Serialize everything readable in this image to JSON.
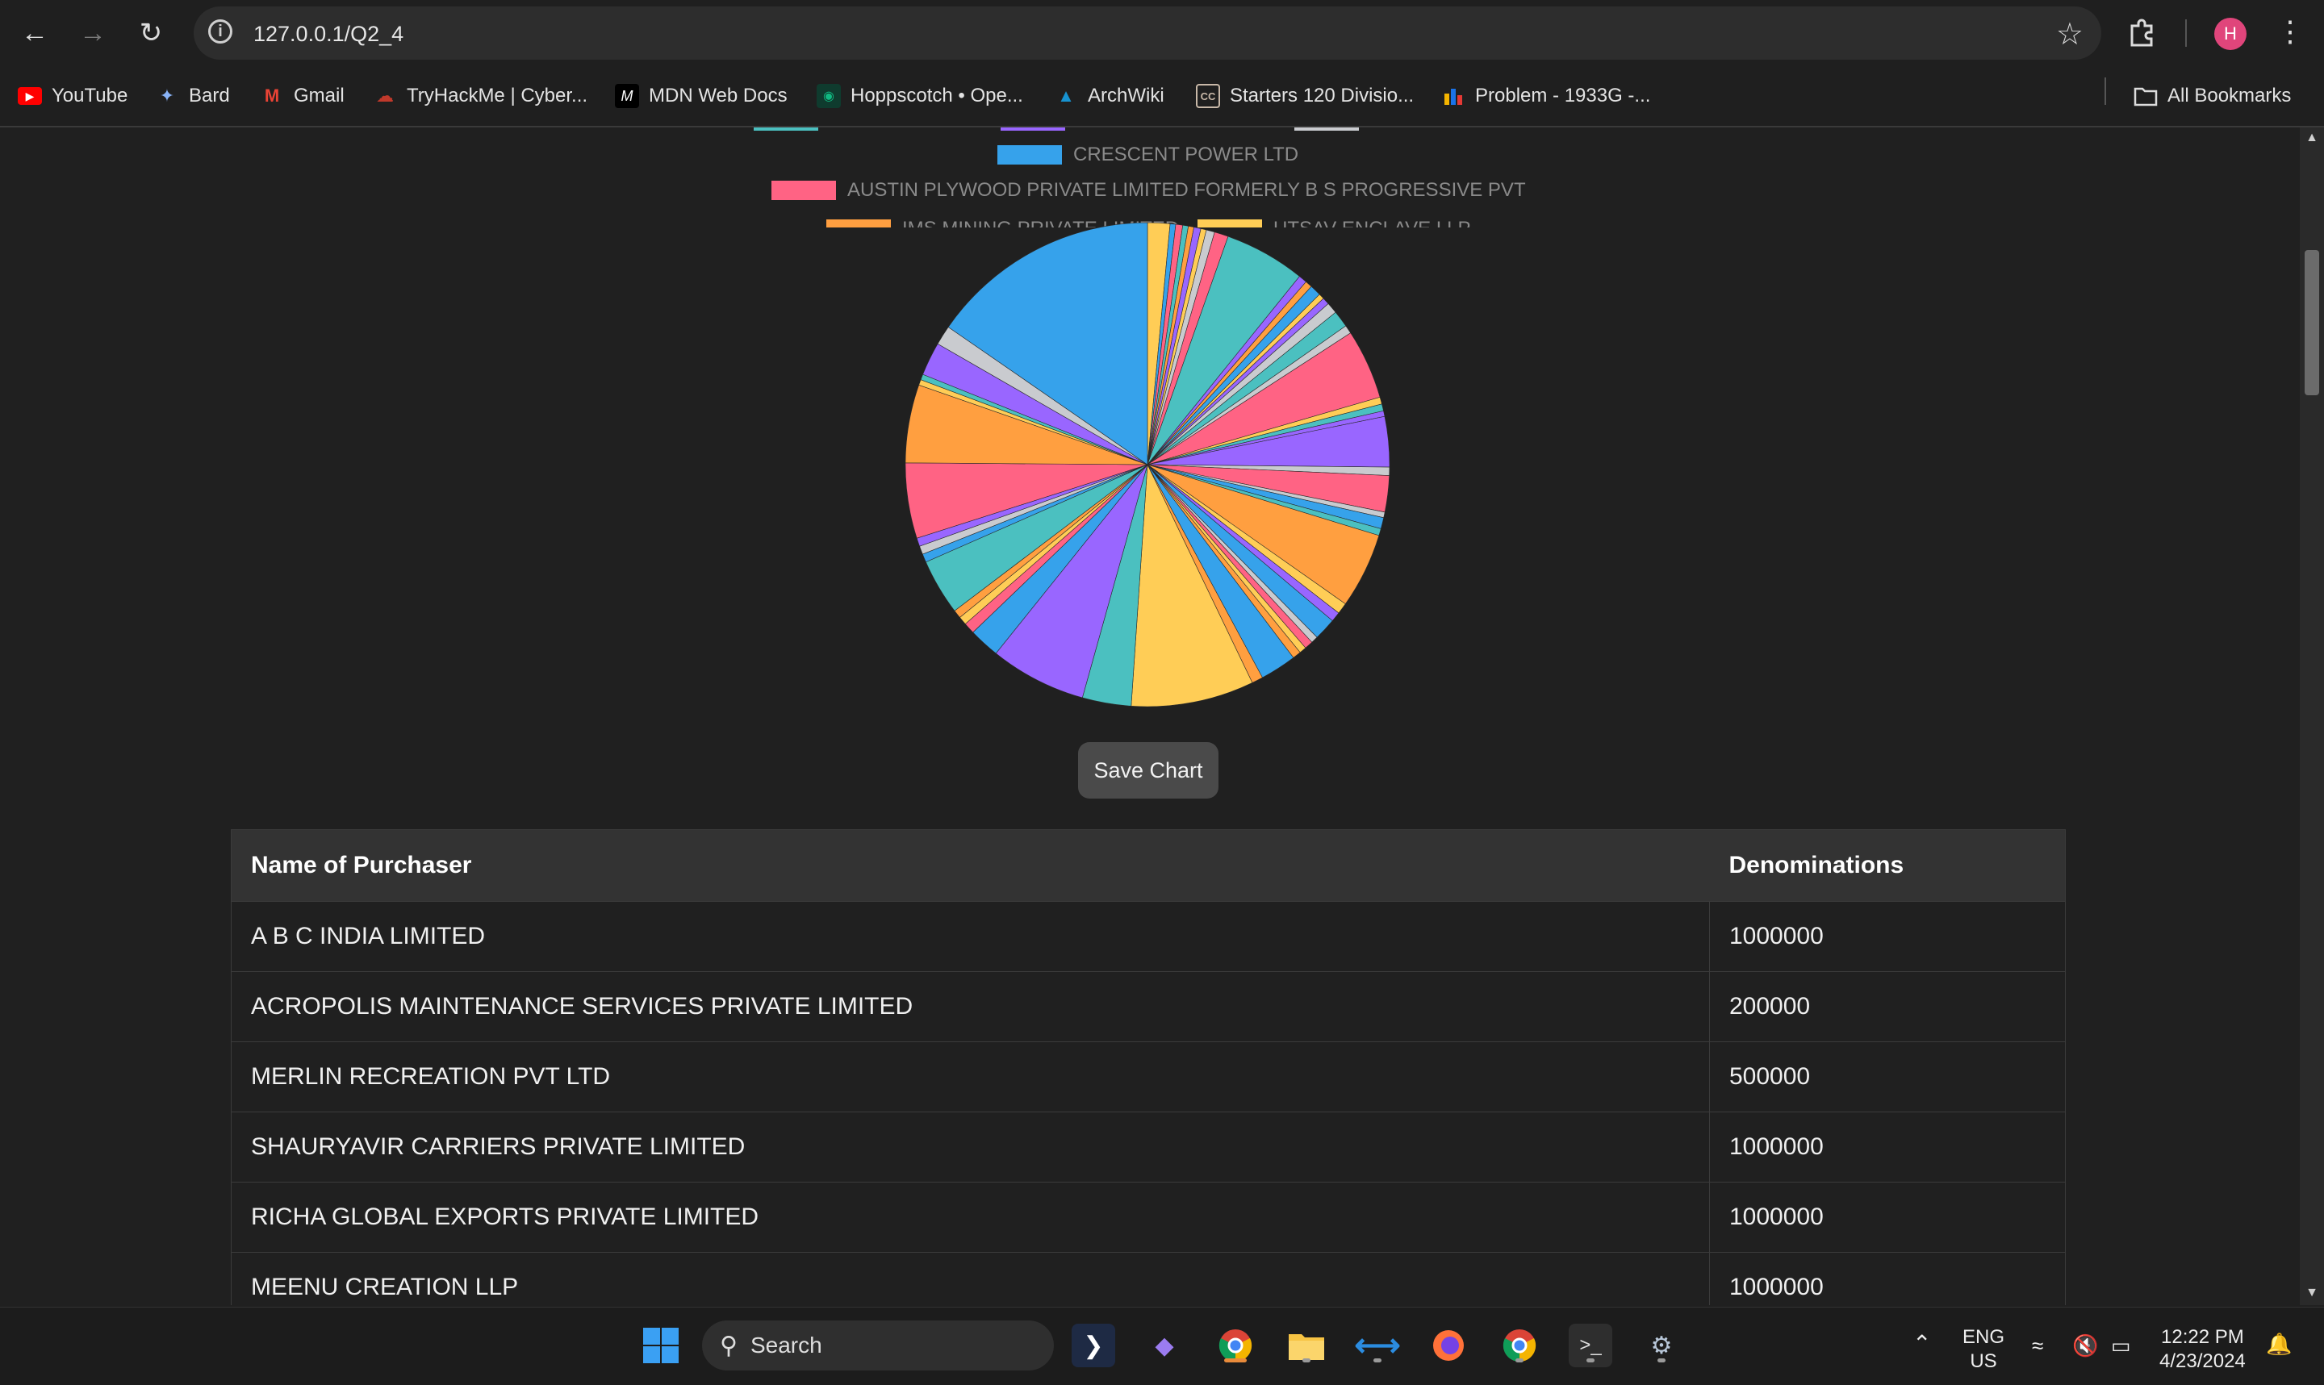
{
  "browser": {
    "url": "127.0.0.1/Q2_4",
    "avatar_letter": "H",
    "bookmarks": [
      {
        "label": "YouTube",
        "icon": "youtube-icon",
        "color": "#ff0000"
      },
      {
        "label": "Bard",
        "icon": "bard-icon",
        "color": "#8ab4f8"
      },
      {
        "label": "Gmail",
        "icon": "gmail-icon",
        "color": "#ea4335"
      },
      {
        "label": "TryHackMe | Cyber...",
        "icon": "tryhackme-icon",
        "color": "#c0392b"
      },
      {
        "label": "MDN Web Docs",
        "icon": "mdn-icon",
        "color": "#ffffff"
      },
      {
        "label": "Hoppscotch • Ope...",
        "icon": "hoppscotch-icon",
        "color": "#10b981"
      },
      {
        "label": "ArchWiki",
        "icon": "archwiki-icon",
        "color": "#1793d1"
      },
      {
        "label": "Starters 120 Divisio...",
        "icon": "codechef-icon",
        "color": "#8d6e63"
      },
      {
        "label": "Problem - 1933G -...",
        "icon": "codeforces-icon",
        "color": "#f4b400"
      }
    ],
    "all_bookmarks_label": "All Bookmarks"
  },
  "legend": [
    {
      "label": "CRESCENT POWER LTD",
      "color": "#36a2eb"
    },
    {
      "label": "AUSTIN PLYWOOD PRIVATE LIMITED FORMERLY B S PROGRESSIVE PVT",
      "color": "#ff6384"
    },
    {
      "label": "IMS MINING PRIVATE LIMITED",
      "color": "#ff9f40"
    },
    {
      "label": "UTSAV ENCLAVE LLP",
      "color": "#ffcd56"
    }
  ],
  "chart_data": {
    "type": "pie",
    "palette": [
      "#36a2eb",
      "#ff6384",
      "#4bc0c0",
      "#ff9f40",
      "#9966ff",
      "#ffcd56",
      "#c9cbcf"
    ],
    "slices": [
      {
        "value": 1.6,
        "color": "#ffcd56"
      },
      {
        "value": 0.4,
        "color": "#36a2eb"
      },
      {
        "value": 0.5,
        "color": "#ff6384"
      },
      {
        "value": 0.4,
        "color": "#4bc0c0"
      },
      {
        "value": 0.4,
        "color": "#ff9f40"
      },
      {
        "value": 0.5,
        "color": "#9966ff"
      },
      {
        "value": 0.4,
        "color": "#ffcd56"
      },
      {
        "value": 0.6,
        "color": "#c9cbcf"
      },
      {
        "value": 1.0,
        "color": "#ff6384"
      },
      {
        "value": 5.8,
        "color": "#4bc0c0"
      },
      {
        "value": 0.6,
        "color": "#9966ff"
      },
      {
        "value": 0.5,
        "color": "#ff9f40"
      },
      {
        "value": 0.8,
        "color": "#36a2eb"
      },
      {
        "value": 0.4,
        "color": "#ffcd56"
      },
      {
        "value": 0.5,
        "color": "#9966ff"
      },
      {
        "value": 0.8,
        "color": "#c9cbcf"
      },
      {
        "value": 1.2,
        "color": "#4bc0c0"
      },
      {
        "value": 0.6,
        "color": "#c9cbcf"
      },
      {
        "value": 5.0,
        "color": "#ff6384"
      },
      {
        "value": 0.5,
        "color": "#ffcd56"
      },
      {
        "value": 0.5,
        "color": "#4bc0c0"
      },
      {
        "value": 0.4,
        "color": "#9966ff"
      },
      {
        "value": 3.6,
        "color": "#9966ff"
      },
      {
        "value": 0.6,
        "color": "#c9cbcf"
      },
      {
        "value": 2.6,
        "color": "#ff6384"
      },
      {
        "value": 0.4,
        "color": "#c9cbcf"
      },
      {
        "value": 0.8,
        "color": "#36a2eb"
      },
      {
        "value": 0.5,
        "color": "#4bc0c0"
      },
      {
        "value": 5.4,
        "color": "#ff9f40"
      },
      {
        "value": 0.8,
        "color": "#ffcd56"
      },
      {
        "value": 0.7,
        "color": "#9966ff"
      },
      {
        "value": 1.6,
        "color": "#36a2eb"
      },
      {
        "value": 0.5,
        "color": "#c9cbcf"
      },
      {
        "value": 0.6,
        "color": "#ff6384"
      },
      {
        "value": 0.5,
        "color": "#ffcd56"
      },
      {
        "value": 0.6,
        "color": "#ff9f40"
      },
      {
        "value": 2.6,
        "color": "#36a2eb"
      },
      {
        "value": 0.8,
        "color": "#ff9f40"
      },
      {
        "value": 8.8,
        "color": "#ffcd56"
      },
      {
        "value": 3.5,
        "color": "#4bc0c0"
      },
      {
        "value": 6.9,
        "color": "#9966ff"
      },
      {
        "value": 2.2,
        "color": "#36a2eb"
      },
      {
        "value": 0.8,
        "color": "#ff6384"
      },
      {
        "value": 0.6,
        "color": "#ffcd56"
      },
      {
        "value": 0.6,
        "color": "#ff9f40"
      },
      {
        "value": 4.0,
        "color": "#4bc0c0"
      },
      {
        "value": 0.6,
        "color": "#36a2eb"
      },
      {
        "value": 0.6,
        "color": "#c9cbcf"
      },
      {
        "value": 0.6,
        "color": "#9966ff"
      },
      {
        "value": 5.4,
        "color": "#ff6384"
      },
      {
        "value": 5.6,
        "color": "#ff9f40"
      },
      {
        "value": 0.4,
        "color": "#ffcd56"
      },
      {
        "value": 0.4,
        "color": "#4bc0c0"
      },
      {
        "value": 2.4,
        "color": "#9966ff"
      },
      {
        "value": 1.4,
        "color": "#c9cbcf"
      },
      {
        "value": 16.5,
        "color": "#36a2eb"
      }
    ]
  },
  "save_button_label": "Save Chart",
  "table": {
    "headers": [
      "Name of Purchaser",
      "Denominations"
    ],
    "rows": [
      [
        "A B C INDIA LIMITED",
        "1000000"
      ],
      [
        "ACROPOLIS MAINTENANCE SERVICES PRIVATE LIMITED",
        "200000"
      ],
      [
        "MERLIN RECREATION PVT LTD",
        "500000"
      ],
      [
        "SHAURYAVIR CARRIERS PRIVATE LIMITED",
        "1000000"
      ],
      [
        "RICHA GLOBAL EXPORTS PRIVATE LIMITED",
        "1000000"
      ],
      [
        "MEENU CREATION LLP",
        "1000000"
      ]
    ]
  },
  "taskbar": {
    "search_placeholder": "Search",
    "lang_top": "ENG",
    "lang_bottom": "US",
    "time": "12:22 PM",
    "date": "4/23/2024"
  }
}
